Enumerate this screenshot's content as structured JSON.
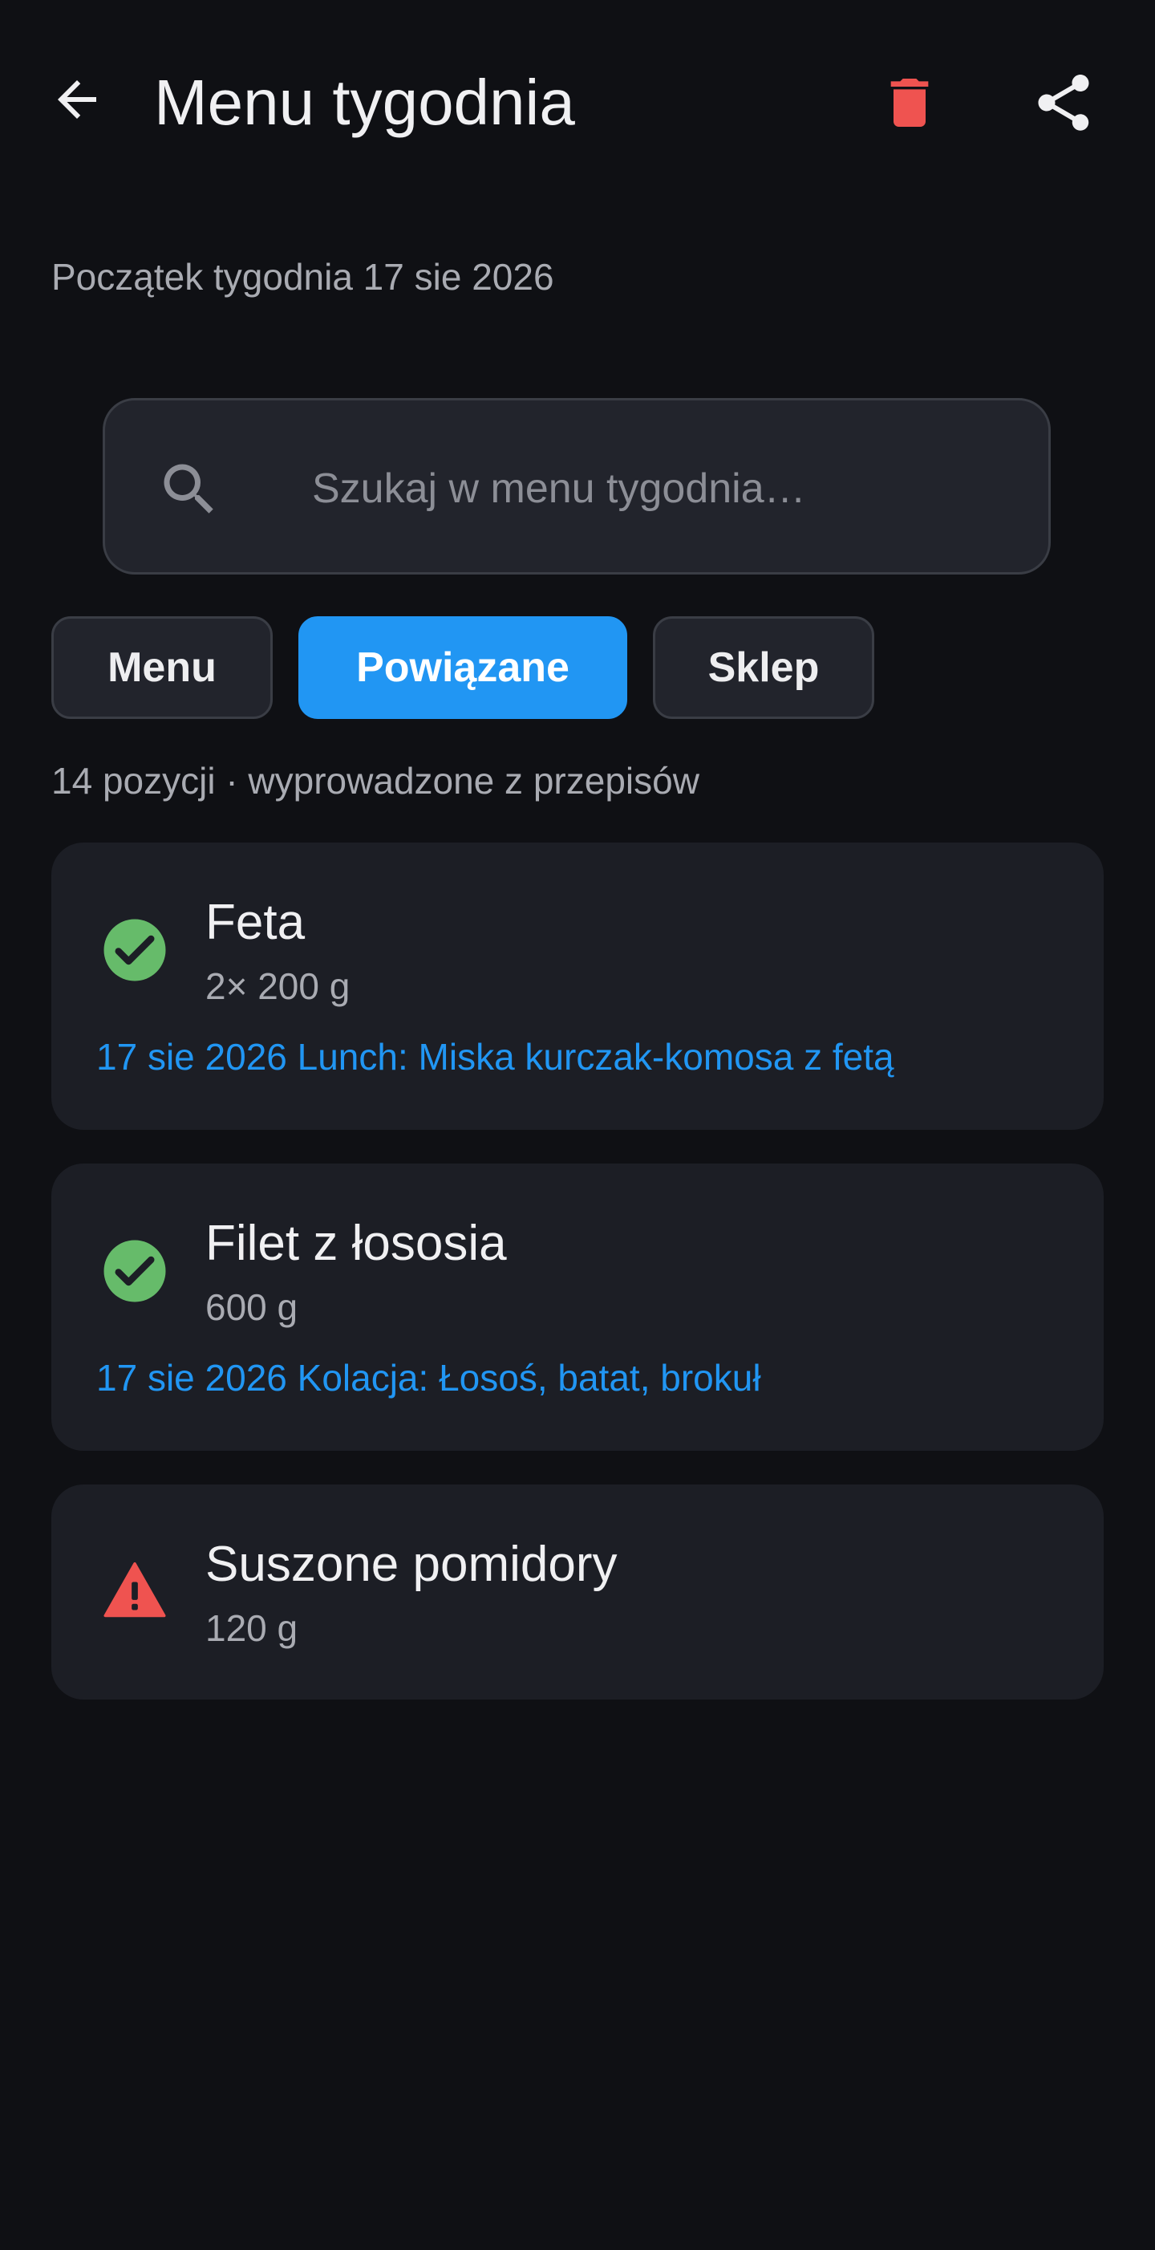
{
  "header": {
    "title": "Menu tygodnia",
    "back_icon": "arrow-left-icon",
    "delete_icon": "trash-icon",
    "share_icon": "share-icon",
    "delete_color": "#ef5350"
  },
  "week_start_text": "Początek tygodnia 17 sie 2026",
  "search": {
    "placeholder": "Szukaj w menu tygodnia…",
    "value": ""
  },
  "tabs": [
    {
      "label": "Menu",
      "active": false
    },
    {
      "label": "Powiązane",
      "active": true
    },
    {
      "label": "Sklep",
      "active": false
    }
  ],
  "summary": "14 pozycji · wyprowadzone z przepisów",
  "items": [
    {
      "name": "Feta",
      "quantity": "2× 200 g",
      "status": "ok",
      "status_icon": "check-circle-icon",
      "link": "17 sie 2026 Lunch: Miska kurczak-komosa z fetą"
    },
    {
      "name": "Filet z łososia",
      "quantity": "600 g",
      "status": "ok",
      "status_icon": "check-circle-icon",
      "link": "17 sie 2026 Kolacja: Łosoś, batat, brokuł"
    },
    {
      "name": "Suszone pomidory",
      "quantity": "120 g",
      "status": "warning",
      "status_icon": "warning-triangle-icon"
    }
  ],
  "colors": {
    "background": "#0f1014",
    "card": "#1c1e25",
    "accent": "#2196f3",
    "ok": "#66bb6a",
    "warning": "#ef5350"
  }
}
